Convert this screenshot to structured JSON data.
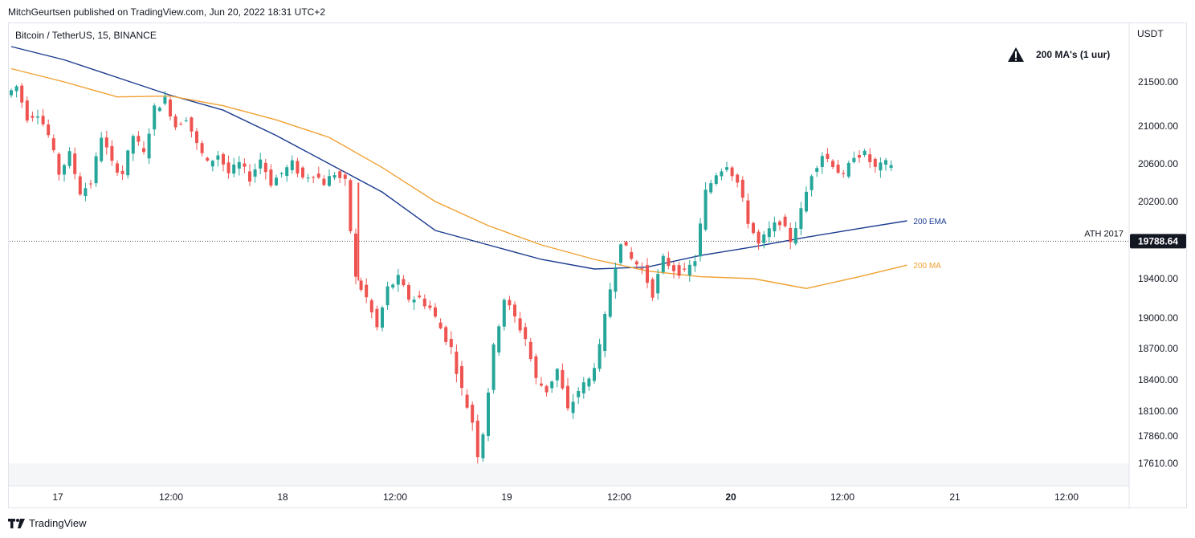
{
  "header": {
    "text": "MitchGeurtsen published on TradingView.com, Jun 20, 2022 18:31 UTC+2"
  },
  "symbol": {
    "text": "Bitcoin / TetherUS, 15, BINANCE"
  },
  "footer": {
    "brand": "TradingView"
  },
  "annotation": {
    "text": "200 MA's (1 uur)",
    "icon": "warning-triangle-icon"
  },
  "colors": {
    "up": "#26a69a",
    "down": "#ef5350",
    "ema": "#1a3a8f",
    "ma": "#f0a030",
    "axis_text": "#131722",
    "grid": "#e0e3eb"
  },
  "chart_data": {
    "type": "candlestick",
    "currency_label": "USDT",
    "y_ticks": [
      21500,
      21000,
      20600,
      20200,
      19400,
      19000,
      18700,
      18400,
      18100,
      17860,
      17610
    ],
    "y_tick_labels": [
      "21500.00",
      "21000.00",
      "20600.00",
      "20200.00",
      "19400.00",
      "19000.00",
      "18700.00",
      "18400.00",
      "18100.00",
      "17860.00",
      "17610.00"
    ],
    "x_ticks": [
      "17",
      "12:00",
      "18",
      "12:00",
      "19",
      "12:00",
      "20",
      "12:00",
      "21",
      "12:00"
    ],
    "x_tick_bold": [
      false,
      false,
      false,
      false,
      false,
      false,
      true,
      false,
      false,
      false
    ],
    "ath": {
      "label": "ATH 2017",
      "value": 19788.64,
      "value_label": "19788.64"
    },
    "indicators": [
      {
        "name": "200 EMA",
        "color": "#1a3a8f",
        "path": [
          [
            0,
            21900
          ],
          [
            10,
            21750
          ],
          [
            20,
            21550
          ],
          [
            30,
            21350
          ],
          [
            40,
            21180
          ],
          [
            50,
            20900
          ],
          [
            60,
            20600
          ],
          [
            70,
            20300
          ],
          [
            80,
            19900
          ],
          [
            90,
            19750
          ],
          [
            100,
            19600
          ],
          [
            110,
            19500
          ],
          [
            120,
            19520
          ],
          [
            130,
            19640
          ],
          [
            140,
            19730
          ],
          [
            150,
            19830
          ],
          [
            160,
            19920
          ],
          [
            169,
            20000
          ]
        ]
      },
      {
        "name": "200 MA",
        "color": "#f0a030",
        "path": [
          [
            0,
            21650
          ],
          [
            10,
            21500
          ],
          [
            20,
            21330
          ],
          [
            30,
            21340
          ],
          [
            40,
            21230
          ],
          [
            50,
            21070
          ],
          [
            60,
            20880
          ],
          [
            70,
            20560
          ],
          [
            80,
            20200
          ],
          [
            90,
            19950
          ],
          [
            100,
            19750
          ],
          [
            110,
            19600
          ],
          [
            120,
            19480
          ],
          [
            130,
            19420
          ],
          [
            140,
            19400
          ],
          [
            150,
            19300
          ],
          [
            160,
            19420
          ],
          [
            169,
            19540
          ]
        ]
      }
    ],
    "price_path": [
      [
        0,
        21350
      ],
      [
        2,
        21450
      ],
      [
        4,
        21100
      ],
      [
        6,
        21150
      ],
      [
        8,
        20900
      ],
      [
        10,
        20500
      ],
      [
        12,
        20700
      ],
      [
        14,
        20300
      ],
      [
        16,
        20400
      ],
      [
        18,
        20900
      ],
      [
        20,
        20600
      ],
      [
        22,
        20500
      ],
      [
        24,
        20900
      ],
      [
        26,
        20700
      ],
      [
        28,
        21200
      ],
      [
        30,
        21300
      ],
      [
        32,
        21000
      ],
      [
        34,
        21100
      ],
      [
        36,
        20800
      ],
      [
        38,
        20600
      ],
      [
        40,
        20700
      ],
      [
        42,
        20500
      ],
      [
        44,
        20600
      ],
      [
        46,
        20450
      ],
      [
        48,
        20650
      ],
      [
        50,
        20400
      ],
      [
        52,
        20500
      ],
      [
        54,
        20600
      ],
      [
        56,
        20450
      ],
      [
        58,
        20500
      ],
      [
        60,
        20400
      ],
      [
        62,
        20500
      ],
      [
        64,
        20400
      ],
      [
        66,
        19400
      ],
      [
        67,
        19300
      ],
      [
        68,
        19200
      ],
      [
        70,
        18900
      ],
      [
        72,
        19300
      ],
      [
        74,
        19400
      ],
      [
        76,
        19200
      ],
      [
        78,
        19200
      ],
      [
        80,
        19100
      ],
      [
        82,
        18900
      ],
      [
        84,
        18700
      ],
      [
        86,
        18300
      ],
      [
        88,
        18000
      ],
      [
        89,
        17700
      ],
      [
        90,
        17900
      ],
      [
        92,
        18700
      ],
      [
        94,
        19200
      ],
      [
        96,
        19000
      ],
      [
        98,
        18800
      ],
      [
        100,
        18400
      ],
      [
        102,
        18300
      ],
      [
        104,
        18500
      ],
      [
        106,
        18100
      ],
      [
        108,
        18300
      ],
      [
        110,
        18400
      ],
      [
        112,
        18700
      ],
      [
        114,
        19300
      ],
      [
        116,
        19800
      ],
      [
        118,
        19600
      ],
      [
        120,
        19500
      ],
      [
        122,
        19250
      ],
      [
        124,
        19600
      ],
      [
        126,
        19500
      ],
      [
        128,
        19450
      ],
      [
        130,
        19600
      ],
      [
        132,
        20300
      ],
      [
        134,
        20500
      ],
      [
        136,
        20600
      ],
      [
        138,
        20400
      ],
      [
        140,
        20000
      ],
      [
        142,
        19750
      ],
      [
        144,
        19900
      ],
      [
        146,
        20000
      ],
      [
        148,
        19800
      ],
      [
        150,
        20100
      ],
      [
        152,
        20500
      ],
      [
        154,
        20700
      ],
      [
        156,
        20600
      ],
      [
        158,
        20450
      ],
      [
        160,
        20700
      ],
      [
        162,
        20700
      ],
      [
        164,
        20550
      ],
      [
        166,
        20600
      ]
    ]
  }
}
